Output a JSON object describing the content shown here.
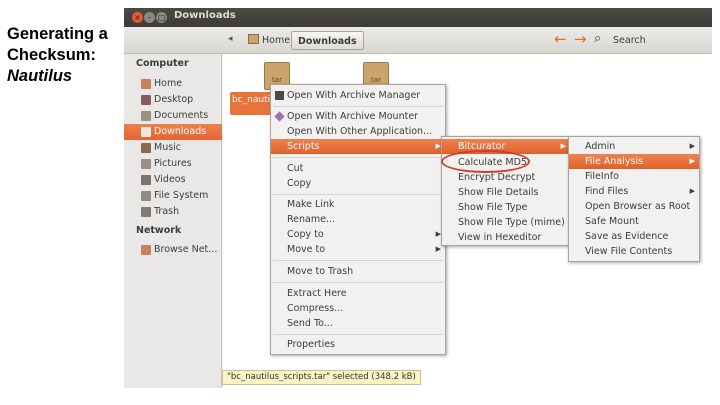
{
  "caption": {
    "line1": "Generating a",
    "line2": "Checksum:",
    "line3": "Nautilus"
  },
  "window": {
    "title": "Downloads",
    "buttons": {
      "close": "×",
      "minimize": "–",
      "maximize": "□"
    }
  },
  "toolbar": {
    "breadcrumb_home": "Home",
    "breadcrumb_current": "Downloads",
    "back_glyph": "←",
    "forward_glyph": "→",
    "search_glyph": "⌕",
    "search_label": "Search"
  },
  "sidebar": {
    "computer_heading": "Computer",
    "network_heading": "Network",
    "computer_items": [
      {
        "label": "Home",
        "icon": "home-icon",
        "color": "#c9815a"
      },
      {
        "label": "Desktop",
        "icon": "desktop-icon",
        "color": "#8a5a64"
      },
      {
        "label": "Documents",
        "icon": "documents-icon",
        "color": "#9a8f84"
      },
      {
        "label": "Downloads",
        "icon": "downloads-icon",
        "color": "#f5e6dc"
      },
      {
        "label": "Music",
        "icon": "music-icon",
        "color": "#8a6a4a"
      },
      {
        "label": "Pictures",
        "icon": "pictures-icon",
        "color": "#9a8f84"
      },
      {
        "label": "Videos",
        "icon": "videos-icon",
        "color": "#7a7470"
      },
      {
        "label": "File System",
        "icon": "filesystem-icon",
        "color": "#8f8c86"
      },
      {
        "label": "Trash",
        "icon": "trash-icon",
        "color": "#7f7c77"
      }
    ],
    "network_items": [
      {
        "label": "Browse Net...",
        "icon": "network-icon",
        "color": "#c9815a"
      }
    ]
  },
  "files": [
    {
      "label": "bc_nautilus_scripts.tar",
      "icon": "tar-archive-icon",
      "icon_text": "tar"
    },
    {
      "label": "",
      "icon": "tar-archive-icon",
      "icon_text": "tar"
    }
  ],
  "context_menu": {
    "items": [
      {
        "label": "Open With Archive Manager",
        "icon": "archive-manager-icon"
      },
      {
        "label": "Open With Archive Mounter",
        "icon": "archive-mounter-icon"
      },
      {
        "label": "Open With Other Application..."
      },
      {
        "label": "Scripts",
        "submenu": true,
        "highlighted": true
      },
      {
        "label": "Cut"
      },
      {
        "label": "Copy"
      },
      {
        "label": "Make Link"
      },
      {
        "label": "Rename..."
      },
      {
        "label": "Copy to",
        "submenu": true
      },
      {
        "label": "Move to",
        "submenu": true
      },
      {
        "label": "Move to Trash"
      },
      {
        "label": "Extract Here"
      },
      {
        "label": "Compress..."
      },
      {
        "label": "Send To..."
      },
      {
        "label": "Properties"
      }
    ]
  },
  "scripts_menu": {
    "items": [
      {
        "label": "Bitcurator",
        "submenu": true,
        "highlighted": true
      },
      {
        "label": "Calculate MD5",
        "circled": true
      },
      {
        "label": "Encrypt Decrypt"
      },
      {
        "label": "Show File Details"
      },
      {
        "label": "Show File Type"
      },
      {
        "label": "Show File Type (mime)"
      },
      {
        "label": "View in Hexeditor"
      }
    ]
  },
  "bitcurator_menu": {
    "items": [
      {
        "label": "Admin",
        "submenu": true
      },
      {
        "label": "File Analysis",
        "submenu": true,
        "highlighted": true
      },
      {
        "label": "FileInfo"
      },
      {
        "label": "Find Files",
        "submenu": true
      },
      {
        "label": "Open Browser as Root"
      },
      {
        "label": "Safe Mount"
      },
      {
        "label": "Save as Evidence"
      },
      {
        "label": "View File Contents"
      }
    ]
  },
  "status": "\"bc_nautilus_scripts.tar\" selected (348.2 kB)",
  "colors": {
    "accent": "#e8733b",
    "annotation_circle": "#d43a2f"
  }
}
